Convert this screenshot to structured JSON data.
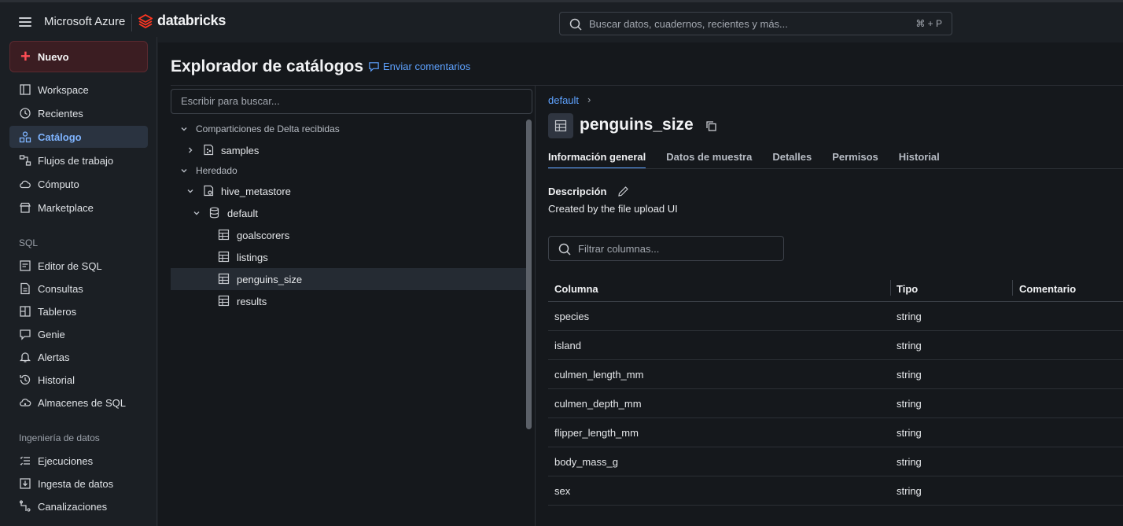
{
  "topbar": {
    "ms_brand": "Microsoft Azure",
    "db_brand": "databricks",
    "search_placeholder": "Buscar datos, cuadernos, recientes y más...",
    "search_shortcut": "⌘ + P"
  },
  "sidebar": {
    "new_label": "Nuevo",
    "items": [
      {
        "label": "Workspace",
        "icon": "workspace-icon"
      },
      {
        "label": "Recientes",
        "icon": "clock-icon"
      },
      {
        "label": "Catálogo",
        "icon": "catalog-icon",
        "active": true
      },
      {
        "label": "Flujos de trabajo",
        "icon": "workflows-icon"
      },
      {
        "label": "Cómputo",
        "icon": "cloud-icon"
      },
      {
        "label": "Marketplace",
        "icon": "marketplace-icon"
      }
    ],
    "sql_section": "SQL",
    "sql_items": [
      {
        "label": "Editor de SQL",
        "icon": "sql-editor-icon"
      },
      {
        "label": "Consultas",
        "icon": "queries-icon"
      },
      {
        "label": "Tableros",
        "icon": "dashboards-icon"
      },
      {
        "label": "Genie",
        "icon": "genie-icon"
      },
      {
        "label": "Alertas",
        "icon": "bell-icon"
      },
      {
        "label": "Historial",
        "icon": "history-icon"
      },
      {
        "label": "Almacenes de SQL",
        "icon": "warehouse-icon"
      }
    ],
    "de_section": "Ingeniería de datos",
    "de_items": [
      {
        "label": "Ejecuciones",
        "icon": "runs-icon"
      },
      {
        "label": "Ingesta de datos",
        "icon": "ingest-icon"
      },
      {
        "label": "Canalizaciones",
        "icon": "pipelines-icon"
      }
    ]
  },
  "main": {
    "title": "Explorador de catálogos",
    "feedback": "Enviar comentarios",
    "tree_search_placeholder": "Escribir para buscar...",
    "tree": [
      {
        "label": "Comparticiones de Delta recibidas",
        "kind": "group"
      },
      {
        "label": "samples",
        "kind": "catalog"
      },
      {
        "label": "Heredado",
        "kind": "group"
      },
      {
        "label": "hive_metastore",
        "kind": "catalog"
      },
      {
        "label": "default",
        "kind": "schema"
      },
      {
        "label": "goalscorers",
        "kind": "table"
      },
      {
        "label": "listings",
        "kind": "table"
      },
      {
        "label": "penguins_size",
        "kind": "table",
        "selected": true
      },
      {
        "label": "results",
        "kind": "table"
      }
    ]
  },
  "detail": {
    "breadcrumb": "default",
    "breadcrumb_sep": "›",
    "title": "penguins_size",
    "tabs": [
      "Información general",
      "Datos de muestra",
      "Detalles",
      "Permisos",
      "Historial"
    ],
    "description_label": "Descripción",
    "description_value": "Created by the file upload UI",
    "filter_placeholder": "Filtrar columnas...",
    "columns_header": [
      "Columna",
      "Tipo",
      "Comentario"
    ],
    "columns": [
      {
        "name": "species",
        "type": "string"
      },
      {
        "name": "island",
        "type": "string"
      },
      {
        "name": "culmen_length_mm",
        "type": "string"
      },
      {
        "name": "culmen_depth_mm",
        "type": "string"
      },
      {
        "name": "flipper_length_mm",
        "type": "string"
      },
      {
        "name": "body_mass_g",
        "type": "string"
      },
      {
        "name": "sex",
        "type": "string"
      }
    ]
  },
  "colors": {
    "accent": "#5ea2ff",
    "brand_red": "#ff3621",
    "active_bg": "#2a3340"
  }
}
